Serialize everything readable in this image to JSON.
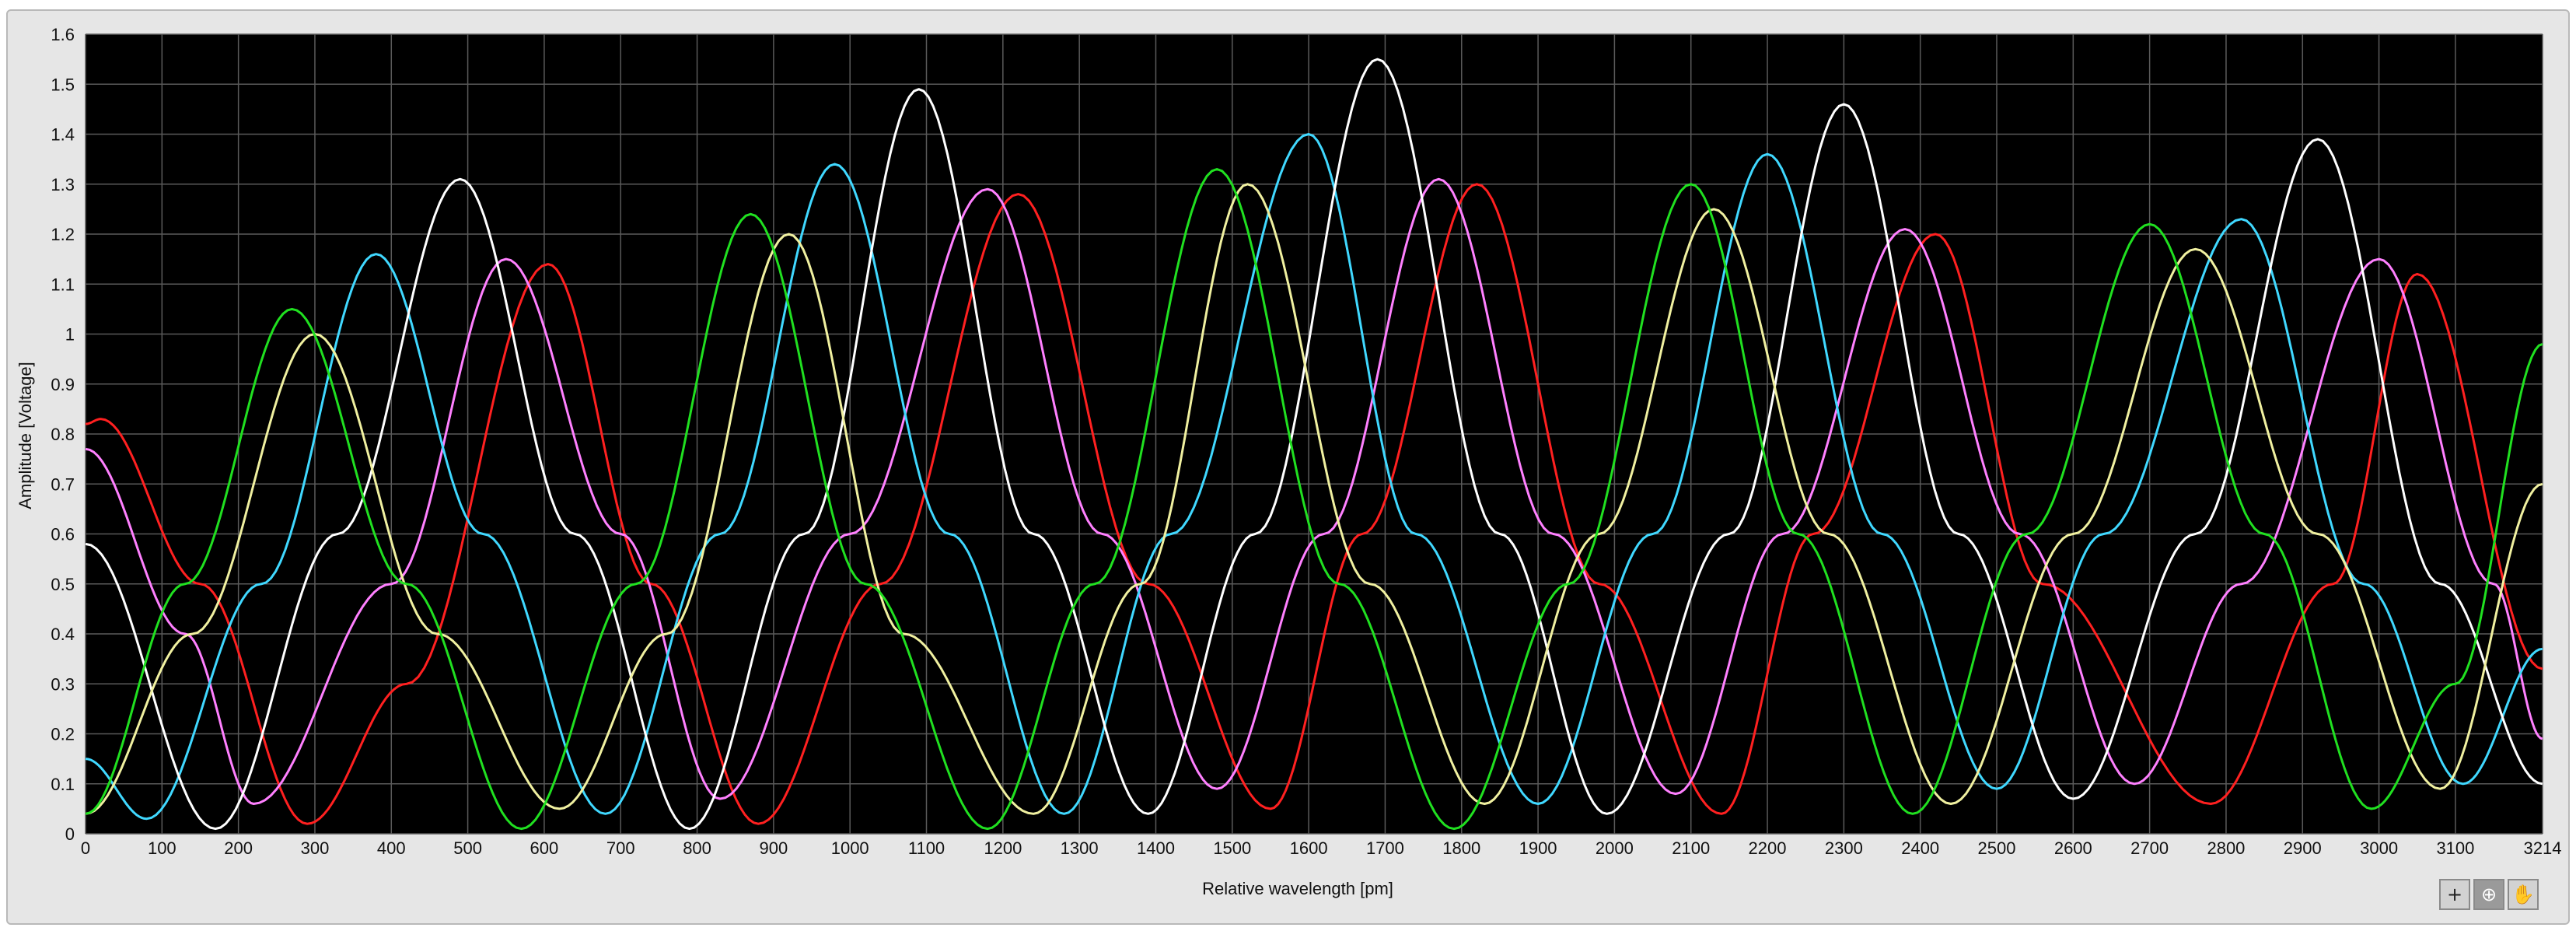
{
  "chart_data": {
    "type": "line",
    "xlabel": "Relative wavelength [pm]",
    "ylabel": "Amplitude [Voltage]",
    "xlim": [
      0,
      3214
    ],
    "ylim": [
      0,
      1.6
    ],
    "x_ticks": [
      0,
      100,
      200,
      300,
      400,
      500,
      600,
      700,
      800,
      900,
      1000,
      1100,
      1200,
      1300,
      1400,
      1500,
      1600,
      1700,
      1800,
      1900,
      2000,
      2100,
      2200,
      2300,
      2400,
      2500,
      2600,
      2700,
      2800,
      2900,
      3000,
      3100,
      3214
    ],
    "x_tick_labels": [
      "0",
      "100",
      "200",
      "300",
      "400",
      "500",
      "600",
      "700",
      "800",
      "900",
      "1000",
      "1100",
      "1200",
      "1300",
      "1400",
      "1500",
      "1600",
      "1700",
      "1800",
      "1900",
      "2000",
      "2100",
      "2200",
      "2300",
      "2400",
      "2500",
      "2600",
      "2700",
      "2800",
      "2900",
      "3000",
      "3100",
      "3214"
    ],
    "y_ticks": [
      0,
      0.1,
      0.2,
      0.3,
      0.4,
      0.5,
      0.6,
      0.7,
      0.8,
      0.9,
      1,
      1.1,
      1.2,
      1.3,
      1.4,
      1.5,
      1.6
    ],
    "y_tick_labels": [
      "0",
      "0.1",
      "0.2",
      "0.3",
      "0.4",
      "0.5",
      "0.6",
      "0.7",
      "0.8",
      "0.9",
      "1",
      "1.1",
      "1.2",
      "1.3",
      "1.4",
      "1.5",
      "1.6"
    ],
    "grid": true,
    "background": "#000000",
    "series": [
      {
        "color": "#ff2020",
        "x": [
          0,
          20,
          150,
          290,
          420,
          605,
          740,
          880,
          1040,
          1220,
          1390,
          1550,
          1670,
          1820,
          1980,
          2140,
          2260,
          2420,
          2560,
          2780,
          2940,
          3050,
          3214
        ],
        "y": [
          0.82,
          0.83,
          0.5,
          0.02,
          0.3,
          1.14,
          0.5,
          0.02,
          0.5,
          1.28,
          0.5,
          0.05,
          0.6,
          1.3,
          0.5,
          0.04,
          0.6,
          1.2,
          0.5,
          0.06,
          0.5,
          1.12,
          0.33
        ]
      },
      {
        "color": "#ff80ff",
        "x": [
          0,
          130,
          220,
          400,
          550,
          700,
          830,
          1000,
          1180,
          1330,
          1480,
          1620,
          1770,
          1920,
          2080,
          2220,
          2380,
          2530,
          2680,
          2820,
          3000,
          3150,
          3214
        ],
        "y": [
          0.77,
          0.4,
          0.06,
          0.5,
          1.15,
          0.6,
          0.07,
          0.6,
          1.29,
          0.6,
          0.09,
          0.6,
          1.31,
          0.6,
          0.08,
          0.6,
          1.21,
          0.6,
          0.1,
          0.5,
          1.15,
          0.5,
          0.19
        ]
      },
      {
        "color": "#40d8ff",
        "x": [
          0,
          80,
          230,
          380,
          520,
          680,
          830,
          980,
          1130,
          1280,
          1420,
          1600,
          1740,
          1900,
          2050,
          2200,
          2350,
          2500,
          2640,
          2820,
          2980,
          3110,
          3214
        ],
        "y": [
          0.15,
          0.03,
          0.5,
          1.16,
          0.6,
          0.04,
          0.6,
          1.34,
          0.6,
          0.04,
          0.6,
          1.4,
          0.6,
          0.06,
          0.6,
          1.36,
          0.6,
          0.09,
          0.6,
          1.23,
          0.5,
          0.1,
          0.37
        ]
      },
      {
        "color": "#ffffff",
        "x": [
          0,
          170,
          330,
          490,
          640,
          790,
          940,
          1090,
          1240,
          1390,
          1530,
          1690,
          1850,
          1990,
          2150,
          2300,
          2450,
          2600,
          2760,
          2920,
          3080,
          3214
        ],
        "y": [
          0.58,
          0.01,
          0.6,
          1.31,
          0.6,
          0.01,
          0.6,
          1.49,
          0.6,
          0.04,
          0.6,
          1.55,
          0.6,
          0.04,
          0.6,
          1.46,
          0.6,
          0.07,
          0.6,
          1.39,
          0.5,
          0.1
        ]
      },
      {
        "color": "#f0f0a0",
        "x": [
          0,
          140,
          300,
          460,
          620,
          760,
          920,
          1070,
          1240,
          1380,
          1520,
          1680,
          1830,
          1980,
          2130,
          2280,
          2440,
          2600,
          2760,
          2920,
          3080,
          3214
        ],
        "y": [
          0.04,
          0.4,
          1.0,
          0.4,
          0.05,
          0.4,
          1.2,
          0.4,
          0.04,
          0.5,
          1.3,
          0.5,
          0.06,
          0.6,
          1.25,
          0.6,
          0.06,
          0.6,
          1.17,
          0.6,
          0.09,
          0.7
        ]
      },
      {
        "color": "#20e020",
        "x": [
          0,
          130,
          270,
          420,
          570,
          720,
          870,
          1020,
          1180,
          1320,
          1480,
          1640,
          1790,
          1940,
          2100,
          2240,
          2390,
          2540,
          2700,
          2850,
          2990,
          3100,
          3214
        ],
        "y": [
          0.04,
          0.5,
          1.05,
          0.5,
          0.01,
          0.5,
          1.24,
          0.5,
          0.01,
          0.5,
          1.33,
          0.5,
          0.01,
          0.5,
          1.3,
          0.6,
          0.04,
          0.6,
          1.22,
          0.6,
          0.05,
          0.3,
          0.98
        ]
      }
    ]
  },
  "tools": [
    "+",
    "⊕",
    "✋"
  ]
}
